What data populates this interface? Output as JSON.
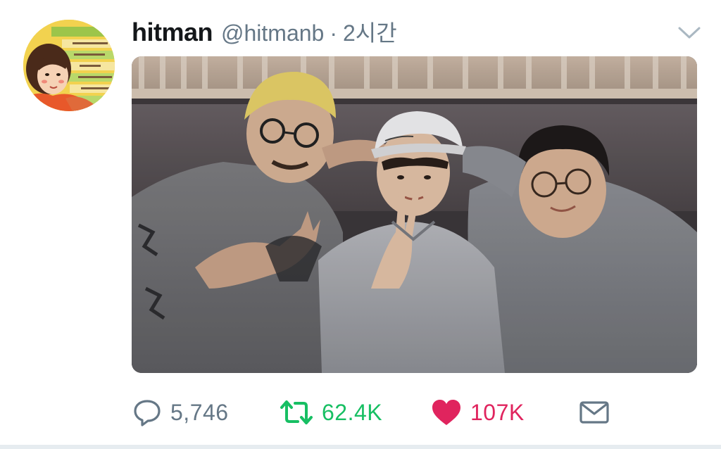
{
  "tweet": {
    "display_name": "hitman",
    "handle": "@hitmanb",
    "separator": "·",
    "timestamp": "2시간",
    "avatar_icon": "cartoon-avatar-icon",
    "menu_icon": "chevron-down-icon",
    "photo": {
      "description_icon": "photo-of-three-people"
    }
  },
  "actions": {
    "reply": {
      "icon": "reply-icon",
      "count": "5,746"
    },
    "retweet": {
      "icon": "retweet-icon",
      "count": "62.4K"
    },
    "like": {
      "icon": "heart-icon",
      "count": "107K",
      "active": true
    },
    "message": {
      "icon": "envelope-icon"
    }
  },
  "colors": {
    "secondary_text": "#657786",
    "retweet_green": "#17bf63",
    "like_red": "#e0245e",
    "divider": "#e6ecf0"
  }
}
